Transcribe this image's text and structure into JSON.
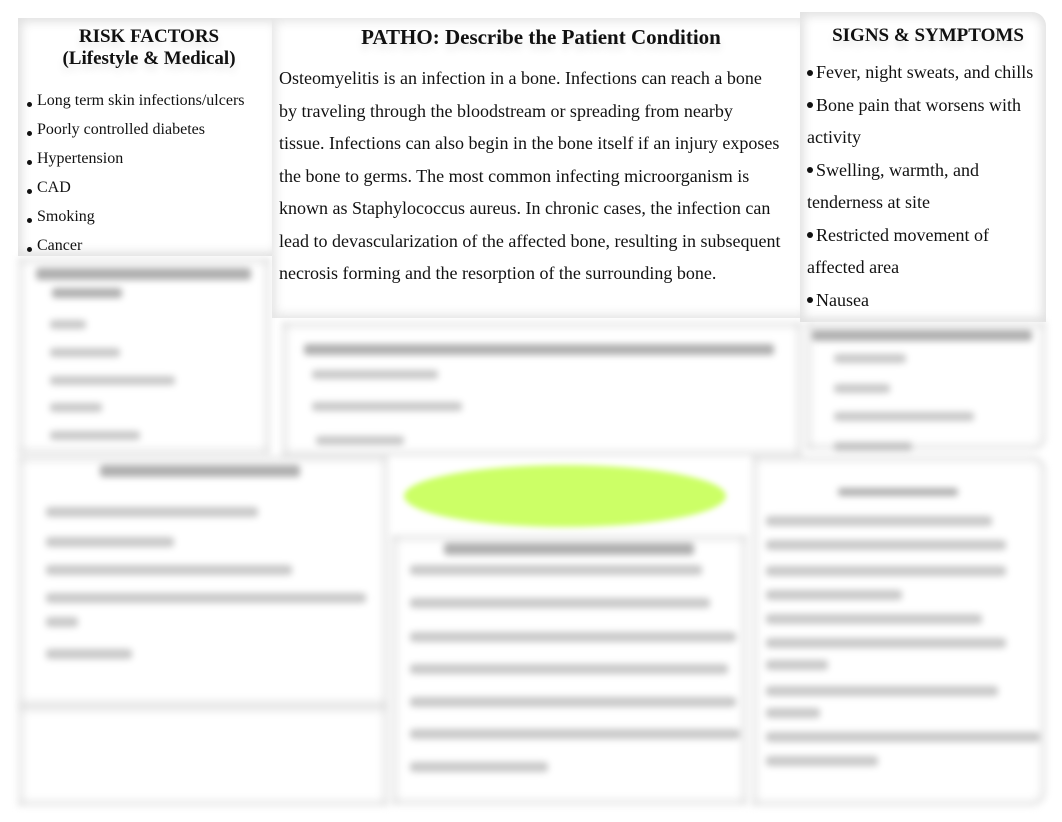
{
  "risk_factors": {
    "title_line1": "RISK FACTORS",
    "title_line2": "(Lifestyle & Medical)",
    "items": [
      "Long term skin infections/ulcers",
      "Poorly controlled diabetes",
      "Hypertension",
      "CAD",
      "Smoking",
      "Cancer"
    ]
  },
  "patho": {
    "title": "PATHO:  Describe the Patient Condition",
    "lines": [
      "Osteomyelitis is an infection in a bone. Infections can reach a bone",
      "by traveling through the bloodstream or spreading from nearby",
      "tissue. Infections can also begin in the bone itself if an injury exposes",
      "the bone to germs. The most common infecting microorganism is",
      "known as Staphylococcus aureus. In chronic cases, the infection can",
      "lead to devascularization of the affected bone, resulting in subsequent",
      "necrosis forming and the resorption of the surrounding bone."
    ]
  },
  "signs_symptoms": {
    "title": "SIGNS & SYMPTOMS",
    "items": [
      {
        "first": "Fever, night sweats, and chills",
        "cont": ""
      },
      {
        "first": "Bone pain that worsens with",
        "cont": "activity"
      },
      {
        "first": "Swelling, warmth, and",
        "cont": "tenderness at site"
      },
      {
        "first": "Restricted movement of",
        "cont": "affected area"
      },
      {
        "first": "Nausea",
        "cont": ""
      }
    ]
  },
  "colors": {
    "highlight_oval": "#ccff66"
  }
}
